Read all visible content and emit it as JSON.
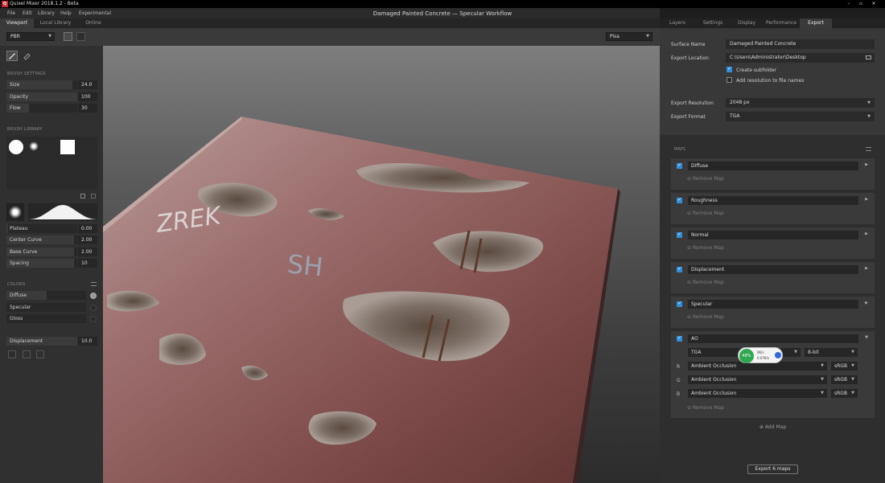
{
  "window": {
    "app_title": "Quixel Mixer 2018.1.2 - Beta",
    "doc_title": "Damaged Painted Concrete — Specular Workflow",
    "controls": [
      "–",
      "▫",
      "✕"
    ]
  },
  "menu": [
    "File",
    "Edit",
    "Library",
    "Help",
    "Experimental"
  ],
  "left_tabs": [
    "Viewport",
    "Local Library",
    "Online"
  ],
  "viewport_toolbar": {
    "mode": "PBR",
    "environment": "Pisa"
  },
  "brush_settings": {
    "title": "BRUSH SETTINGS",
    "size": {
      "label": "Size",
      "value": "24.0"
    },
    "opacity": {
      "label": "Opacity",
      "value": "100"
    },
    "flow": {
      "label": "Flow",
      "value": "30"
    }
  },
  "brush_library": {
    "title": "BRUSH LIBRARY"
  },
  "falloff": {
    "plateau": {
      "label": "Plateau",
      "value": "0.00"
    },
    "center_curve": {
      "label": "Center Curve",
      "value": "2.00"
    },
    "base_curve": {
      "label": "Base Curve",
      "value": "2.00"
    },
    "spacing": {
      "label": "Spacing",
      "value": "10"
    }
  },
  "colors": {
    "title": "COLORS",
    "items": [
      "Diffuse",
      "Specular",
      "Gloss"
    ]
  },
  "displacement": {
    "label": "Displacement",
    "value": "10.0"
  },
  "right_tabs": [
    "Layers",
    "Settings",
    "Display",
    "Performance",
    "Export"
  ],
  "export": {
    "surface_name_label": "Surface Name",
    "surface_name": "Damaged Painted Concrete",
    "location_label": "Export Location",
    "location": "C:\\Users\\Administrator\\Desktop",
    "create_subfolder": "Create subfolder",
    "add_resolution": "Add resolution to file names",
    "resolution_label": "Export Resolution",
    "resolution": "2048 px",
    "format_label": "Export Format",
    "format": "TGA"
  },
  "maps": {
    "title": "MAPS",
    "remove_label": "Remove Map",
    "items": [
      "Diffuse",
      "Roughness",
      "Normal",
      "Displacement",
      "Specular",
      "AO"
    ],
    "ao": {
      "format": "TGA",
      "bitdepth": "8-bit",
      "channels": [
        {
          "ch": "R",
          "source": "Ambient Occlusion",
          "space": "sRGB"
        },
        {
          "ch": "G",
          "source": "Ambient Occlusion",
          "space": "sRGB"
        },
        {
          "ch": "B",
          "source": "Ambient Occlusion",
          "space": "sRGB"
        }
      ]
    },
    "add_map": "Add Map"
  },
  "overlay": {
    "percent": "48%",
    "up": "0K/s",
    "down": "0.07K/s"
  },
  "export_button": "Export 6 maps",
  "graffiti": [
    "ZREK",
    "SH"
  ]
}
